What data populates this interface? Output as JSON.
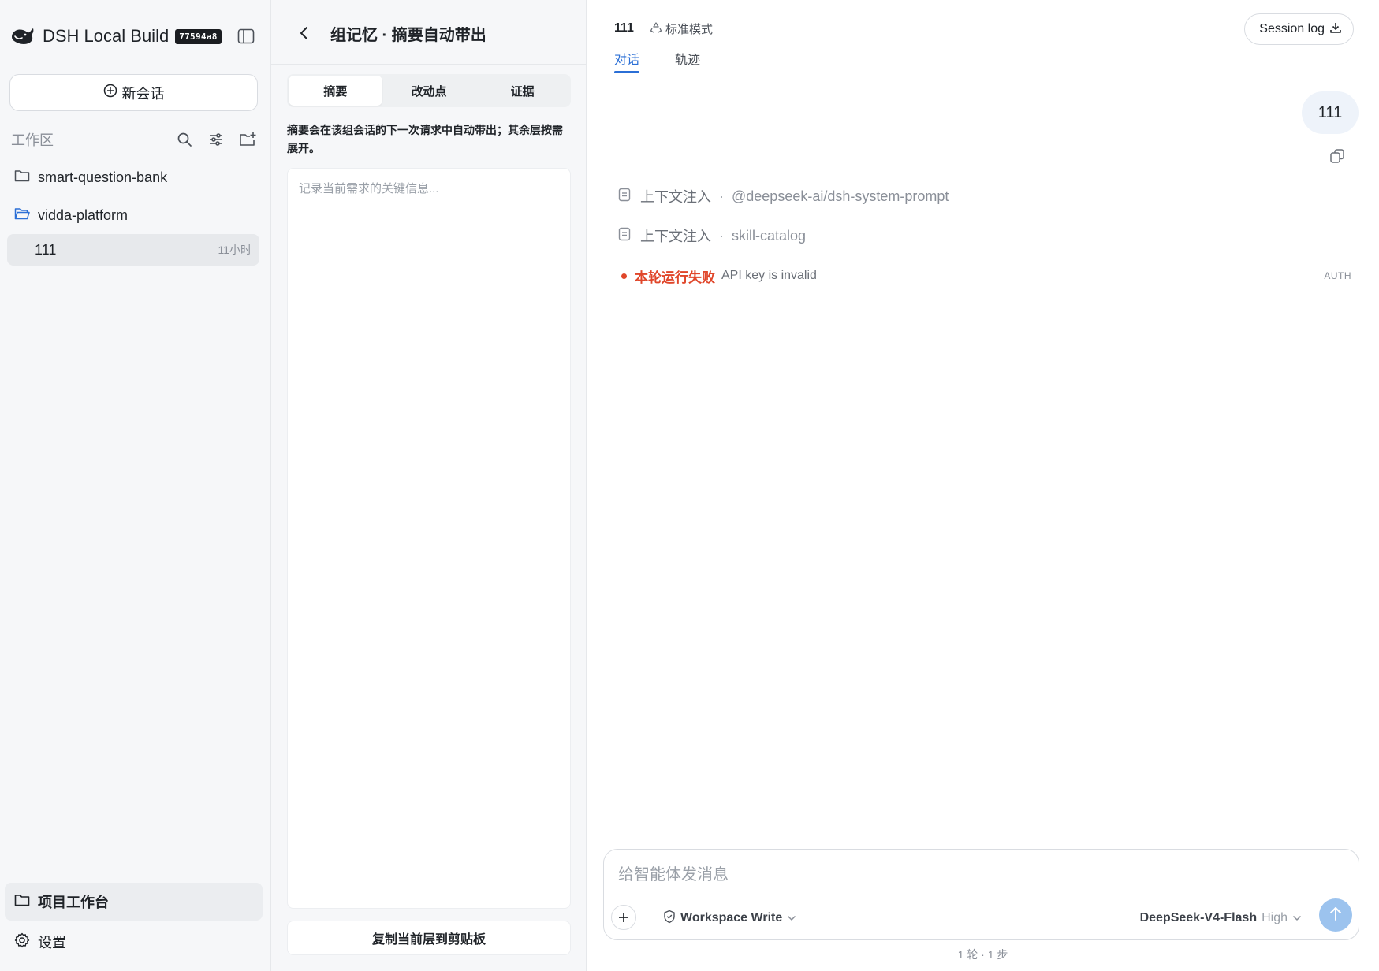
{
  "sidebar": {
    "brand_title": "DSH Local Build",
    "build_badge": "77594a8",
    "new_chat_label": "新会话",
    "workspace_label": "工作区",
    "folders": [
      {
        "name": "smart-question-bank",
        "icon": "folder-icon"
      },
      {
        "name": "vidda-platform",
        "icon": "folder-open-icon"
      }
    ],
    "session": {
      "title": "111",
      "time": "11小时"
    },
    "bottom": {
      "project_label": "项目工作台",
      "settings_label": "设置"
    }
  },
  "memory_panel": {
    "title": "组记忆 · 摘要自动带出",
    "tabs": [
      "摘要",
      "改动点",
      "证据"
    ],
    "active_tab": "摘要",
    "hint": "摘要会在该组会话的下一次请求中自动带出；其余层按需展开。",
    "textarea_placeholder": "记录当前需求的关键信息...",
    "copy_button_label": "复制当前层到剪贴板"
  },
  "main": {
    "session_title": "111",
    "mode_label": "标准模式",
    "tabs": [
      "对话",
      "轨迹"
    ],
    "active_tab": "对话",
    "session_log_label": "Session log",
    "user_message": "111",
    "context_rows": [
      {
        "label": "上下文注入",
        "name": "@deepseek-ai/dsh-system-prompt"
      },
      {
        "label": "上下文注入",
        "name": "skill-catalog"
      }
    ],
    "error": {
      "title": "本轮运行失败",
      "message": "API key is invalid",
      "code": "AUTH"
    },
    "composer": {
      "placeholder": "给智能体发消息",
      "permission_label": "Workspace Write",
      "model_name": "DeepSeek-V4-Flash",
      "model_level": "High"
    },
    "footer_stat": "1 轮 · 1 步"
  },
  "colors": {
    "accent": "#2b6fd6",
    "error": "#e0462a",
    "send_button": "#9cc3ee",
    "sidebar_bg": "#f6f7f9"
  }
}
